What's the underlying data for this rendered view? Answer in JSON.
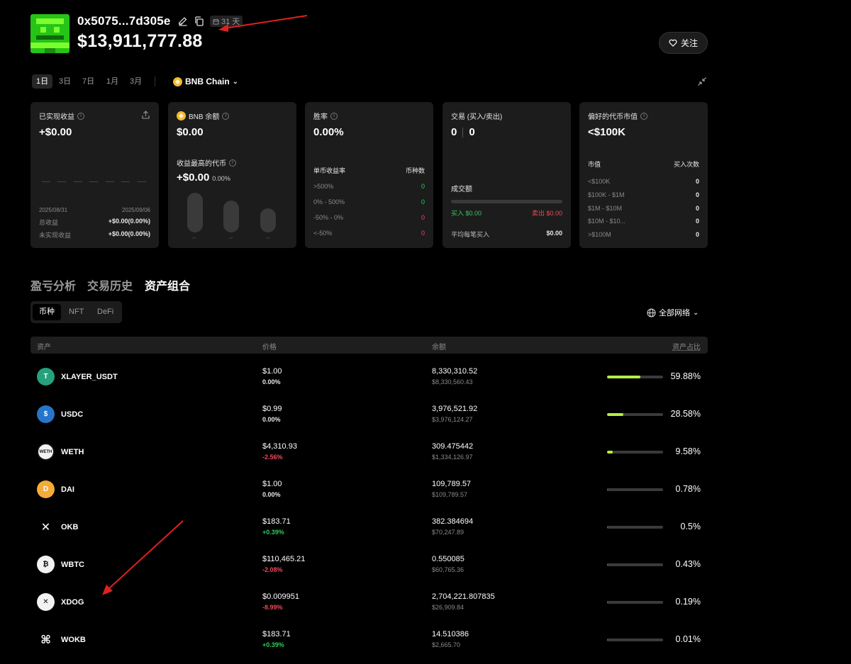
{
  "header": {
    "wallet_address": "0x5075...7d305e",
    "days_badge": "31 天",
    "total_value": "$13,911,777.88",
    "follow_label": "关注"
  },
  "periods": [
    "1日",
    "3日",
    "7日",
    "1月",
    "3月"
  ],
  "active_period": "1日",
  "chain": {
    "label": "BNB Chain"
  },
  "cards": {
    "realized": {
      "title": "已实现收益",
      "value": "+$0.00",
      "date_start": "2025/08/31",
      "date_end": "2025/09/06",
      "total_label": "总收益",
      "total_value": "+$0.00(0.00%)",
      "unrealized_label": "未实现收益",
      "unrealized_value": "+$0.00(0.00%)"
    },
    "bnb": {
      "title": "BNB 余额",
      "value": "$0.00",
      "top_label": "收益最高的代币",
      "top_value": "+$0.00",
      "top_pct": "0.00%",
      "pill_labels": [
        "--",
        "--",
        "--"
      ]
    },
    "winrate": {
      "title": "胜率",
      "value": "0.00%",
      "col1": "单币收益率",
      "col2": "币种数",
      "rows": [
        {
          "label": ">500%",
          "count": "0",
          "color": "green"
        },
        {
          "label": "0% - 500%",
          "count": "0",
          "color": "green"
        },
        {
          "label": "-50% - 0%",
          "count": "0",
          "color": "red"
        },
        {
          "label": "<-50%",
          "count": "0",
          "color": "red"
        }
      ]
    },
    "trades": {
      "title": "交易 (买入/卖出)",
      "buys": "0",
      "sells": "0",
      "volume_label": "成交额",
      "buy_label": "买入 $0.00",
      "sell_label": "卖出 $0.00",
      "avg_label": "平均每笔买入",
      "avg_value": "$0.00"
    },
    "mcap": {
      "title": "偏好的代币市值",
      "value": "<$100K",
      "col1": "市值",
      "col2": "买入次数",
      "rows": [
        {
          "label": "<$100K",
          "count": "0"
        },
        {
          "label": "$100K - $1M",
          "count": "0"
        },
        {
          "label": "$1M - $10M",
          "count": "0"
        },
        {
          "label": "$10M - $10...",
          "count": "0"
        },
        {
          "label": ">$100M",
          "count": "0"
        }
      ]
    }
  },
  "section_tabs": [
    "盈亏分析",
    "交易历史",
    "资产组合"
  ],
  "active_section": "资产组合",
  "asset_tabs": [
    "币种",
    "NFT",
    "DeFi"
  ],
  "active_asset_tab": "币种",
  "network_select": "全部网络",
  "table": {
    "headers": {
      "asset": "资产",
      "price": "价格",
      "balance": "余额",
      "share": "资产占比"
    },
    "rows": [
      {
        "name": "XLAYER_USDT",
        "icon": "tether-icon",
        "icon_bg": "#26a17b",
        "icon_glyph": "T",
        "price": "$1.00",
        "change": "0.00%",
        "change_color": "neutral",
        "balance": "8,330,310.52",
        "balance_usd": "$8,330,560.43",
        "share_fraction": 0.5988,
        "share": "59.88%"
      },
      {
        "name": "USDC",
        "icon": "usdc-icon",
        "icon_bg": "#2775ca",
        "icon_glyph": "$",
        "price": "$0.99",
        "change": "0.00%",
        "change_color": "neutral",
        "balance": "3,976,521.92",
        "balance_usd": "$3,976,124.27",
        "share_fraction": 0.2858,
        "share": "28.58%"
      },
      {
        "name": "WETH",
        "icon": "weth-icon",
        "icon_bg": "#f2f2f2",
        "icon_glyph": "WETH",
        "price": "$4,310.93",
        "change": "-2.56%",
        "change_color": "red",
        "balance": "309.475442",
        "balance_usd": "$1,334,126.97",
        "share_fraction": 0.0958,
        "share": "9.58%"
      },
      {
        "name": "DAI",
        "icon": "dai-icon",
        "icon_bg": "#f5ac37",
        "icon_glyph": "D",
        "price": "$1.00",
        "change": "0.00%",
        "change_color": "neutral",
        "balance": "109,789.57",
        "balance_usd": "$109,789.57",
        "share_fraction": 0.0078,
        "share": "0.78%"
      },
      {
        "name": "OKB",
        "icon": "okb-icon",
        "icon_bg": "#000000",
        "icon_glyph": "✕",
        "price": "$183.71",
        "change": "+0.39%",
        "change_color": "green",
        "balance": "382.384694",
        "balance_usd": "$70,247.89",
        "share_fraction": 0.005,
        "share": "0.5%"
      },
      {
        "name": "WBTC",
        "icon": "wbtc-icon",
        "icon_bg": "#f2f2f2",
        "icon_glyph": "₿",
        "price": "$110,465.21",
        "change": "-2.08%",
        "change_color": "red",
        "balance": "0.550085",
        "balance_usd": "$60,765.36",
        "share_fraction": 0.0043,
        "share": "0.43%"
      },
      {
        "name": "XDOG",
        "icon": "xdog-icon",
        "icon_bg": "#f2f2f2",
        "icon_glyph": "✕",
        "price": "$0.009951",
        "change": "-8.99%",
        "change_color": "red",
        "balance": "2,704,221.807835",
        "balance_usd": "$26,909.84",
        "share_fraction": 0.0019,
        "share": "0.19%"
      },
      {
        "name": "WOKB",
        "icon": "wokb-icon",
        "icon_bg": "#000000",
        "icon_glyph": "⌘",
        "price": "$183.71",
        "change": "+0.39%",
        "change_color": "green",
        "balance": "14.510386",
        "balance_usd": "$2,665.70",
        "share_fraction": 0.0001,
        "share": "0.01%"
      }
    ]
  },
  "colors": {
    "accent_green": "#b4f042",
    "up": "#2fcc5c",
    "down": "#f0485a",
    "annotation": "#e02020"
  }
}
